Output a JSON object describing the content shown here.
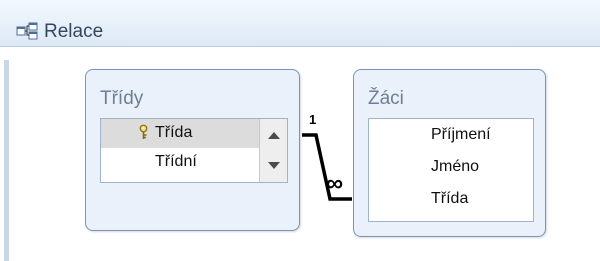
{
  "window": {
    "title": "Relace",
    "icon": "relationships-icon"
  },
  "tables": [
    {
      "name": "Třídy",
      "fields": [
        {
          "label": "Třída",
          "primary_key": true,
          "selected": true
        },
        {
          "label": "Třídní",
          "primary_key": false,
          "selected": false
        }
      ],
      "scrollbar": true
    },
    {
      "name": "Žáci",
      "fields": [
        {
          "label": "Příjmení"
        },
        {
          "label": "Jméno"
        },
        {
          "label": "Třída"
        }
      ],
      "scrollbar": false
    }
  ],
  "relationship": {
    "from_table": "Třídy",
    "from_field": "Třída",
    "to_table": "Žáci",
    "to_field": "Třída",
    "one_label": "1",
    "many_symbol": "∞",
    "type": "one-to-many"
  },
  "colors": {
    "accent": "#dde9f6",
    "table_border": "#7b95b8",
    "table_bg": "#eaf1fa",
    "line": "#000000"
  }
}
